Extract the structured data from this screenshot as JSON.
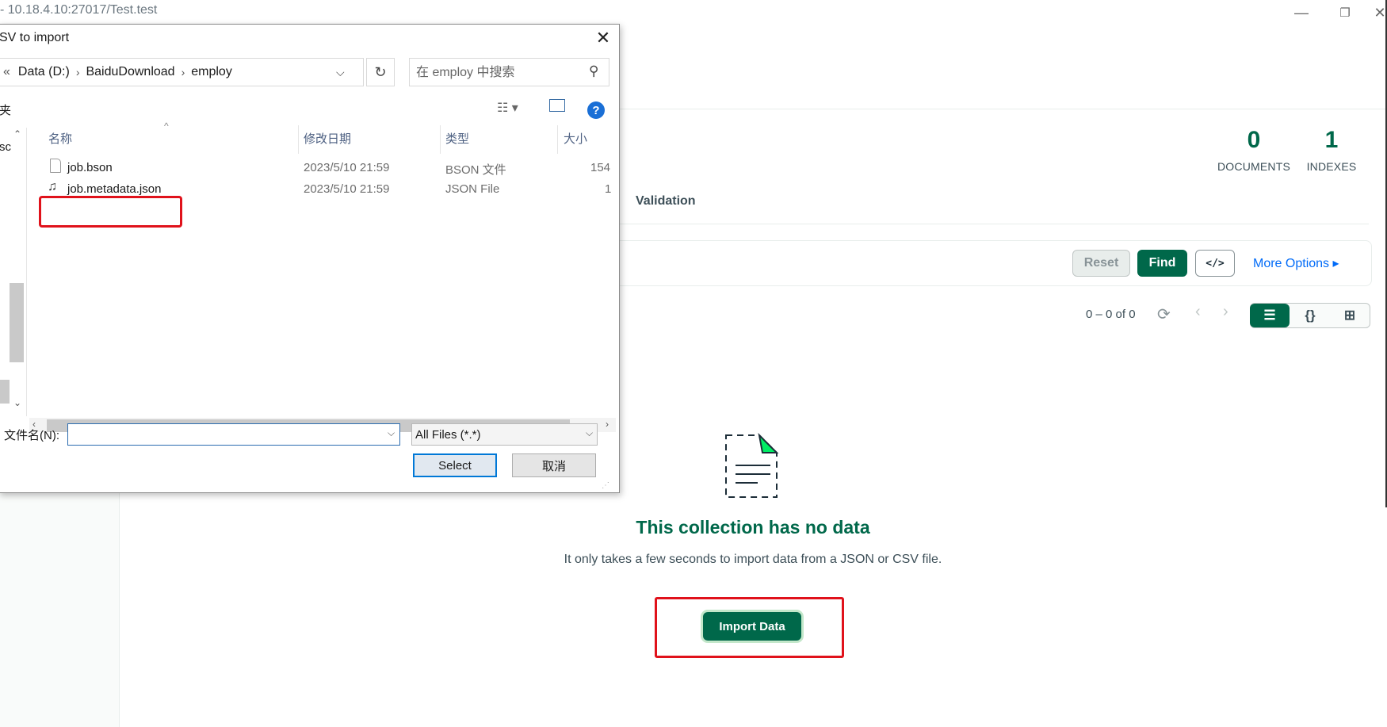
{
  "app": {
    "title": "- 10.18.4.10:27017/Test.test",
    "window_controls": {
      "minimize": "—",
      "restore": "❐",
      "close": "✕"
    }
  },
  "collection": {
    "stats": [
      {
        "value": "0",
        "label": "DOCUMENTS"
      },
      {
        "value": "1",
        "label": "INDEXES"
      }
    ],
    "tab_validation": "Validation",
    "query_bar": {
      "reset_label": "Reset",
      "find_label": "Find",
      "code_label": "</>",
      "more_options_label": "More Options ▸"
    },
    "pager": {
      "text": "0 – 0 of 0"
    },
    "empty_state": {
      "title": "This collection has no data",
      "description": "It only takes a few seconds to import data from a JSON or CSV file.",
      "import_label": "Import Data"
    }
  },
  "dialog": {
    "title": "SV to import",
    "address": {
      "back_glyph": "«",
      "crumbs": [
        "Data (D:)",
        "BaiduDownload",
        "employ"
      ]
    },
    "search_placeholder": "在 employ 中搜索",
    "toolbar_left": "夹",
    "nav_label": "sc",
    "columns": {
      "name": "名称",
      "modified": "修改日期",
      "type": "类型",
      "size": "大小"
    },
    "files": [
      {
        "name": "job.bson",
        "modified": "2023/5/10 21:59",
        "type": "BSON 文件",
        "size": "154"
      },
      {
        "name": "job.metadata.json",
        "modified": "2023/5/10 21:59",
        "type": "JSON File",
        "size": "1"
      }
    ],
    "filename_label": "文件名(N):",
    "filename_value": "",
    "filter_selected": "All Files (*.*)",
    "select_label": "Select",
    "cancel_label": "取消"
  },
  "colors": {
    "brand_green": "#00684a",
    "link_blue": "#016bf8",
    "highlight_red": "#e0121b"
  }
}
